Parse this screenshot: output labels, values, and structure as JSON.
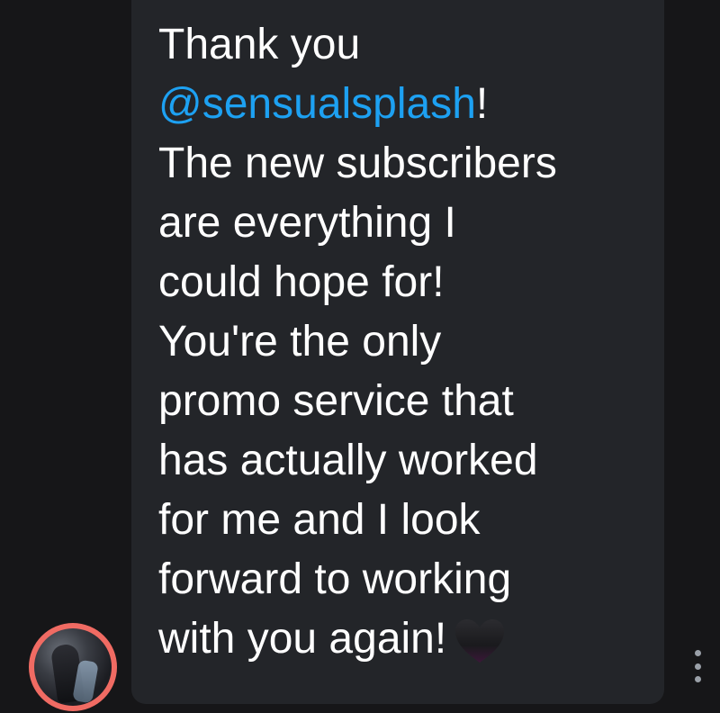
{
  "message": {
    "line1": "Thank you",
    "mention": "@sensualsplash",
    "mention_suffix": "!",
    "line3": "The new subscribers",
    "line4": "are everything I",
    "line5": "could hope for!",
    "line6": "You're the only",
    "line7": "promo service that",
    "line8": "has actually worked",
    "line9": "for me and I look",
    "line10": "forward to working",
    "line11": "with you again!",
    "emoji": "black-heart-icon"
  },
  "colors": {
    "background": "#161618",
    "bubble": "#232529",
    "text": "#ffffff",
    "mention": "#1da1f2",
    "avatar_ring": "#f06b63",
    "more_dots": "#9aa0a8"
  },
  "icons": {
    "avatar": "user-avatar-photo",
    "more": "more-vertical-icon"
  }
}
